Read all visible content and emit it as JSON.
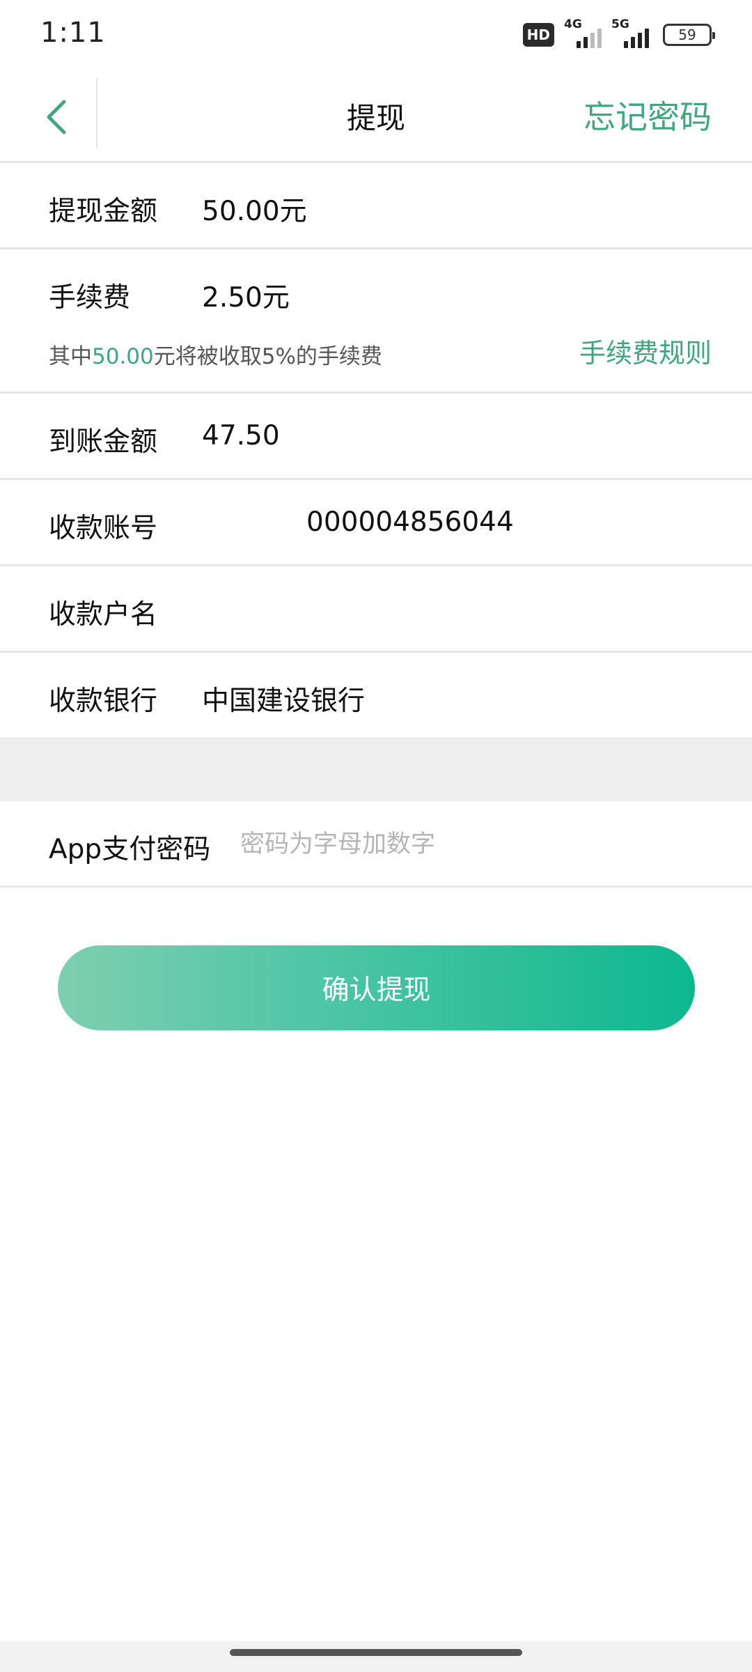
{
  "status_bar": {
    "time": "1:11",
    "hd_label": "HD",
    "network_1": "4G",
    "network_2": "5G",
    "battery": "59"
  },
  "nav": {
    "title": "提现",
    "forgot_password": "忘记密码"
  },
  "form": {
    "withdraw_amount": {
      "label": "提现金额",
      "value": "50.00元"
    },
    "fee": {
      "label": "手续费",
      "value": "2.50元",
      "note_prefix": "其中",
      "note_amount": "50.00",
      "note_suffix": "元将被收取5%的手续费",
      "rule_link": "手续费规则"
    },
    "received_amount": {
      "label": "到账金额",
      "value": "47.50"
    },
    "account_number": {
      "label": "收款账号",
      "value": "000004856044"
    },
    "account_name": {
      "label": "收款户名",
      "value": ""
    },
    "bank": {
      "label": "收款银行",
      "value": "中国建设银行"
    },
    "password": {
      "label": "App支付密码",
      "placeholder": "密码为字母加数字"
    }
  },
  "confirm_button": "确认提现",
  "colors": {
    "accent": "#3fa67f",
    "button_gradient_start": "#7ecfb1",
    "button_gradient_end": "#0cb890",
    "divider": "#e6e6e6",
    "band": "#eeeeee"
  },
  "icons": {
    "back": "chevron-left-icon",
    "signal": "signal-bars-icon",
    "battery": "battery-icon"
  }
}
